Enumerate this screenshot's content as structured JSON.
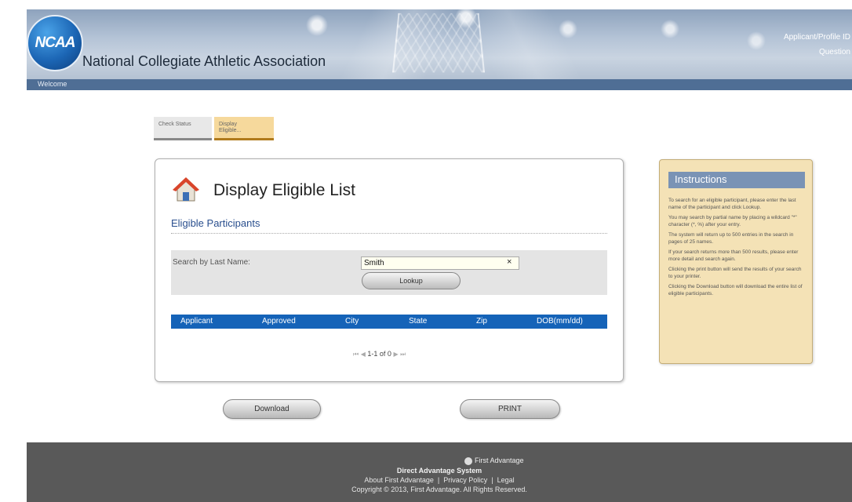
{
  "header": {
    "logo_text": "NCAA",
    "org_name": "National Collegiate Athletic Association",
    "top_right_link_1": "Applicant/Profile ID",
    "top_right_link_2": "Question",
    "welcome": "Welcome"
  },
  "tabs": [
    {
      "label_line1": "Check Status",
      "label_line2": ""
    },
    {
      "label_line1": "Display",
      "label_line2": "Eligible..."
    }
  ],
  "panel": {
    "title": "Display Eligible List",
    "subtitle": "Eligible Participants",
    "search_label": "Search by Last Name:",
    "search_value": "Smith",
    "clear_symbol": "×",
    "lookup_label": "Lookup"
  },
  "table": {
    "columns": [
      "Applicant",
      "Approved",
      "City",
      "State",
      "Zip",
      "DOB(mm/dd)"
    ]
  },
  "pager": {
    "text": "1-1 of 0"
  },
  "buttons": {
    "download": "Download",
    "print": "PRINT"
  },
  "instructions": {
    "title": "Instructions",
    "paragraphs": [
      "To search for an eligible participant, please enter the last name of the participant and click Lookup.",
      "You may search by partial name by placing a wildcard \"*\" character (*, %) after your entry.",
      "The system will return up to 500 entries in the search in pages of 25 names.",
      "If your search returns more than 500 results, please enter more detail and search again.",
      "Clicking the print button will send the results of your search to your printer.",
      "Clicking the Download button will download the entire list of eligible participants."
    ]
  },
  "footer": {
    "brand": "First Advantage",
    "system": "Direct Advantage System",
    "link_about": "About First Advantage",
    "link_privacy": "Privacy Policy",
    "link_legal": "Legal",
    "separator": "|",
    "copyright": "Copyright © 2013, First Advantage. All Rights Reserved."
  },
  "colors": {
    "header_bar": "#4f6e95",
    "table_header": "#1563b8",
    "instructions_bg": "#f4e2b6",
    "active_tab": "#f6d99c",
    "footer_bg": "#595959"
  }
}
